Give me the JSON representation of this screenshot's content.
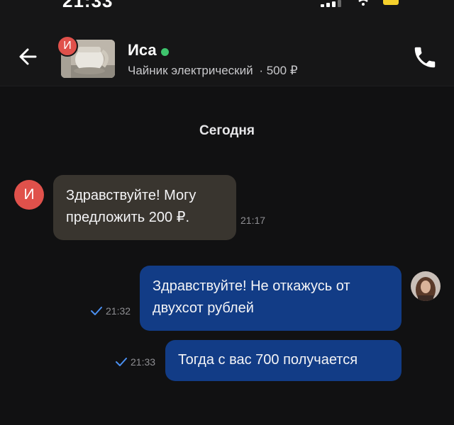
{
  "status_bar": {
    "time": "21:33"
  },
  "header": {
    "contact_name": "Иса",
    "contact_initial": "И",
    "product_title": "Чайник электрический",
    "price": "· 500 ₽",
    "online": true
  },
  "chat": {
    "day_label": "Сегодня",
    "messages": [
      {
        "direction": "incoming",
        "sender_initial": "И",
        "text_line1": "Здравствуйте! Могу",
        "text_line2": "предложить 200 ₽.",
        "time": "21:17"
      },
      {
        "direction": "outgoing",
        "text_line1": "Здравствуйте! Не откажусь от",
        "text_line2": "двухсот рублей",
        "time": "21:32",
        "read": true
      },
      {
        "direction": "outgoing",
        "text_line1": "Тогда с вас 700 получается",
        "time": "21:33",
        "read": true
      }
    ]
  },
  "colors": {
    "background": "#111112",
    "incoming_bubble": "#39352f",
    "outgoing_bubble": "#123c86",
    "avatar_red": "#e0514b",
    "online_green": "#3ec46d",
    "check_blue": "#4a8ff0"
  },
  "icons": {
    "back": "arrow-left-icon",
    "call": "phone-icon",
    "read": "checkmark-icon"
  }
}
